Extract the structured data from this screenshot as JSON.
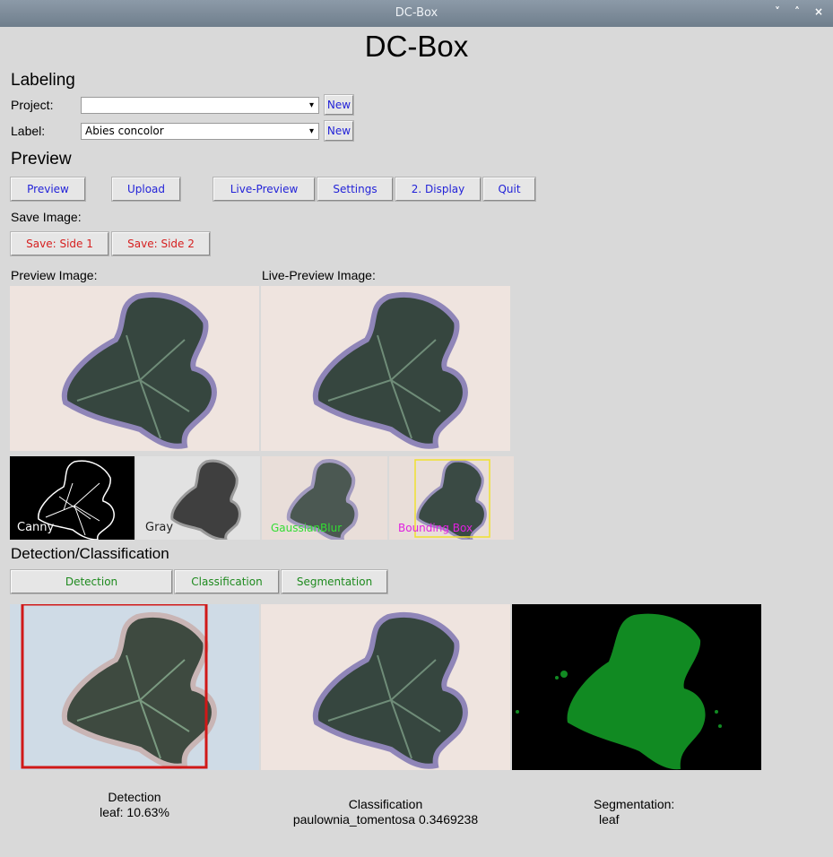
{
  "window": {
    "title": "DC-Box",
    "controls": [
      "˅",
      "˄",
      "×"
    ]
  },
  "app_title": "DC-Box",
  "labeling": {
    "heading": "Labeling",
    "project_label": "Project:",
    "project_value": "",
    "label_label": "Label:",
    "label_value": "Abies concolor",
    "new_button": "New"
  },
  "preview": {
    "heading": "Preview",
    "buttons": [
      "Preview",
      "Upload",
      "Live-Preview",
      "Settings",
      "2. Display",
      "Quit"
    ],
    "save_label": "Save Image:",
    "save_buttons": [
      "Save: Side 1",
      "Save: Side 2"
    ],
    "preview_image_label": "Preview Image:",
    "live_preview_image_label": "Live-Preview Image:",
    "thumbnails": [
      "Canny",
      "Gray",
      "GaussianBlur",
      "Bounding Box"
    ]
  },
  "detection": {
    "heading": "Detection/Classification",
    "buttons": [
      "Detection",
      "Classification",
      "Segmentation"
    ],
    "detection_caption": "Detection",
    "detection_result": "leaf: 10.63%",
    "classification_caption": "Classification",
    "classification_result": "paulownia_tomentosa 0.3469238",
    "segmentation_caption": "Segmentation:",
    "segmentation_result": "leaf"
  },
  "colors": {
    "button_text": "#2323d8",
    "save_text": "#d61f1f",
    "detect_text": "#1e8a1e",
    "accent_bbox": "#f0e030",
    "detect_box": "#d01818"
  }
}
